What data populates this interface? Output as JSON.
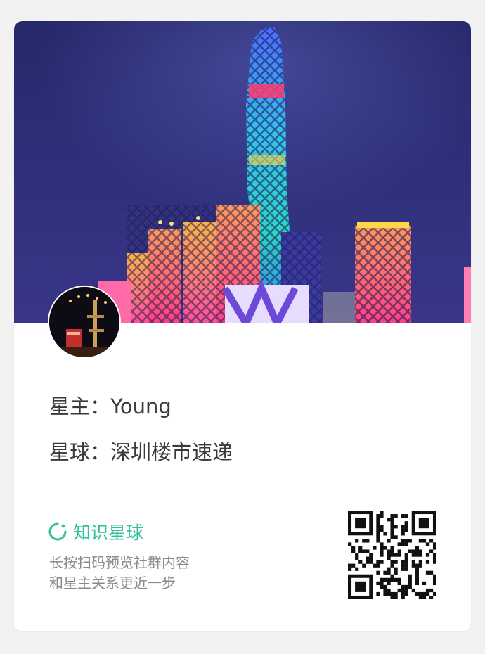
{
  "owner": {
    "label": "星主：",
    "name": "Young"
  },
  "planet": {
    "label": "星球：",
    "name": "深圳楼市速递"
  },
  "brand": {
    "name": "知识星球",
    "color": "#2fbf99",
    "icon": "knowledge-planet-logo-icon"
  },
  "hint": {
    "line1": "长按扫码预览社群内容",
    "line2": "和星主关系更近一步"
  },
  "colors": {
    "background": "#f2f2f3",
    "card": "#ffffff",
    "text": "#3a3a3a",
    "muted": "#8a8a8a"
  }
}
